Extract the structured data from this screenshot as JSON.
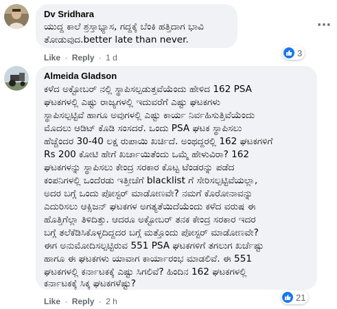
{
  "comments": [
    {
      "author": "Dv Sridhara",
      "lines": [
        "ಯುದ್ದ ಕಾಲೆ ಶ್ರಸ್ತಾಭ್ಯಾಸ, ಗದ್ದಕ್ಕೆ ಬೆಂಕಿ ಹತ್ತಿದಾಗ ಭಾವಿ",
        "ತೋಡುವುದ.better late than never."
      ],
      "like_label": "Like",
      "reply_label": "Reply",
      "time": "1 d",
      "reaction_count": "3",
      "reaction_icon": "like-thumb-icon",
      "accent_color": "#1877f2"
    },
    {
      "author": "Almeida Gladson",
      "lines": [
        "ಕಳೆದ ಅಕ್ಟೋಬರ್ ನಲ್ಲಿ ಸ್ಥಾಪಿಸಲ್ಪಡುತ್ತವೆಯೆಂದು ಹೇಳಿದ 162 PSA",
        "ಘಟಕಗಳಲ್ಲಿ ಎಷ್ಟು ರಾಜ್ಯಗಳಲ್ಲಿ ಇದುವರೆಗೆ ಎಷ್ಟು ಘಟಕಗಳು",
        "ಸ್ಥಾಪಿಸಲ್ಪಟ್ಟಿವೆ ಹಾಗೂ ಅವುಗಳಲ್ಲಿ ಎಷ್ಟು ಕಾರ್ಯ ನಿರ್ವಹಿಸುತ್ತಿವೆಯೆಂದು",
        "ಮೊದಲು ಆಡಿಟ್ ಕೊಡಿ ಸಂಸದರೆ. ಒಂದು PSA ಘಟಕ ಸ್ಥಾಪಿಸಲು",
        "ಹೆಚ್ಚೆಂದರ 30-40 ಲಕ್ಷ ರುಪಾಯಿ ಖರ್ಚಿದೆ. ಅಂಥದ್ದರಲ್ಲಿ 162 ಘಟಕಗಳಿಗೆ",
        "Rs 200 ಕೋಟಿ ಹೇಗೆ ಖರ್ಚಾಯಿತೆಂದು ಒಮ್ಮೆ ಹೇಳುವಿರಾ? 162",
        "ಘಟಕಗಳನ್ನು ಸ್ಥಾಪಿಸಲು ಕೇಂದ್ರ ಸರಕಾರ ಕೊಟ್ಟ ಟೆಂಡರನ್ನು ಪಡೆದ",
        "ಕಂಪನಿಗಳಲ್ಲಿ ಒಂದೆರಡು ಇತ್ತೀಚೆಗೆ blacklist ಗೆ ಸೇರಿಸಲ್ಪಟ್ಟಿವೆಯಲ್ಲಾ,",
        "ಅದರ ಬಗ್ಗೆ ಒಂದು ಪೋಸ್ಟರ್ ಮಾಡೋಣವೇ? ನಮಗೆ ಕೊರೋನಾವನ್ನು",
        "ಎದುರಿಸಲು ಆಕ್ಸಿಜನ್ ಘಟಕಗಳ ಅಗತ್ಯತೆಯಿದೆಯೆಂದು ಕಳೆದ ವರುಷ ಈ",
        "ಹೊತ್ತಿಗೆಲ್ಲಾ ತಿಳಿದಿತ್ತು. ಆದರೂ ಅಕ್ಟೋಬರ್ ತನಕ ಕೇಂದ್ರ ಸರಕಾರ ಇದರ",
        "ಬಗ್ಗೆ ತಲೆಕೆಡಿಸಿಕೊಳ್ಳದಿದ್ದದರ ಬಗ್ಗೆ ಮತ್ತೊಂದು ಪೋಸ್ಟರ್ ಮಾಡೋಣವೇ?",
        "ಈಗ ಅನುಮೋದಿಸಲ್ಪಟ್ಟಿರುವ 551 PSA ಘಟಕಗಳಿಗೆ ತಗಲುಗ ಖರ್ಚೆಷ್ಟು",
        "ಹಾಗೂ ಈ ಘಟಕಗಳು ಯಾವಾಗ ಕಾರ್ಯಾರಂಭ ಮಾಡಲಿವೆ. ಈ 551",
        "ಘಟಕಗಳಲ್ಲಿ ಕರ್ನಾಟಕಕ್ಕೆ ಎಷ್ಟು ಸಿಗಲಿವೆ? ಹಿಂದಿನ 162 ಘಟಕಗಳಲ್ಲಿ",
        "ಕರ್ನಾಟಕಕ್ಕೆ ಸಿಕ್ಕ ಘಟಕಗಳೆಷ್ಟು?"
      ],
      "like_label": "Like",
      "reply_label": "Reply",
      "time": "2 h",
      "reaction_count": "21",
      "reaction_icon": "like-thumb-icon",
      "accent_color": "#1877f2"
    }
  ],
  "more_icon": "more-options-icon"
}
